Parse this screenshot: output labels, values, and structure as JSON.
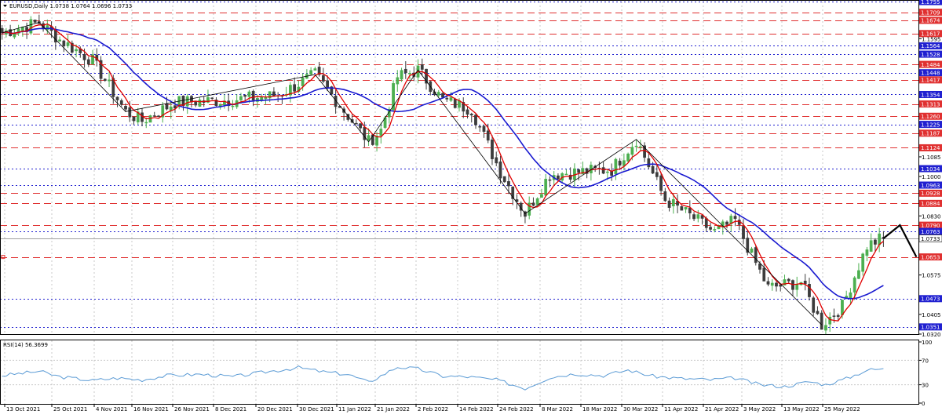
{
  "header": {
    "title": "EURUSD,Daily  1.0738 1.0764 1.0696 1.0733",
    "rsi_label": "RSI(14) 56.3699"
  },
  "colors": {
    "bull": "#4caf50",
    "bear": "#3c3c3c",
    "ma_fast": "#e00000",
    "ma_slow": "#1a1ad0",
    "support": "#2020d0",
    "resistance": "#e03030",
    "rsi_line": "#5b9bd5",
    "grid": "#c8c8c8"
  },
  "chart_data": [
    {
      "type": "candlestick",
      "instrument": "EURUSD",
      "timeframe": "Daily",
      "ohlc_latest": {
        "open": 1.0738,
        "high": 1.0764,
        "low": 1.0696,
        "close": 1.0733
      },
      "ylim": [
        1.032,
        1.1755
      ],
      "x_ticks": [
        "13 Oct 2021",
        "25 Oct 2021",
        "4 Nov 2021",
        "16 Nov 2021",
        "26 Nov 2021",
        "8 Dec 2021",
        "20 Dec 2021",
        "30 Dec 2021",
        "11 Jan 2022",
        "21 Jan 2022",
        "2 Feb 2022",
        "14 Feb 2022",
        "24 Feb 2022",
        "8 Mar 2022",
        "18 Mar 2022",
        "30 Mar 2022",
        "11 Apr 2022",
        "21 Apr 2022",
        "3 May 2022",
        "13 May 2022",
        "25 May 2022"
      ],
      "y_ticks_plain": [
        1.1595,
        1.1085,
        1.1,
        1.083,
        1.0575,
        1.0405,
        1.032
      ],
      "levels": [
        {
          "value": 1.1755,
          "label": "1.1755",
          "kind": "support"
        },
        {
          "value": 1.1709,
          "label": "1.1709",
          "kind": "resistance"
        },
        {
          "value": 1.1674,
          "label": "1.1674",
          "kind": "resistance"
        },
        {
          "value": 1.1617,
          "label": "1.1617",
          "kind": "resistance"
        },
        {
          "value": 1.1564,
          "label": "1.1564",
          "kind": "support"
        },
        {
          "value": 1.1528,
          "label": "1.1528",
          "kind": "support"
        },
        {
          "value": 1.1484,
          "label": "1.1484",
          "kind": "resistance"
        },
        {
          "value": 1.1448,
          "label": "1.1448",
          "kind": "support"
        },
        {
          "value": 1.1417,
          "label": "1.1417",
          "kind": "resistance"
        },
        {
          "value": 1.1354,
          "label": "1.1354",
          "kind": "support"
        },
        {
          "value": 1.1313,
          "label": "1.1313",
          "kind": "resistance"
        },
        {
          "value": 1.126,
          "label": "1.1260",
          "kind": "resistance"
        },
        {
          "value": 1.1225,
          "label": "1.1225",
          "kind": "support"
        },
        {
          "value": 1.1187,
          "label": "1.1187",
          "kind": "resistance"
        },
        {
          "value": 1.1124,
          "label": "1.1124",
          "kind": "resistance"
        },
        {
          "value": 1.1034,
          "label": "1.1034",
          "kind": "support"
        },
        {
          "value": 1.0963,
          "label": "1.0963",
          "kind": "support"
        },
        {
          "value": 1.0928,
          "label": "1.0928",
          "kind": "resistance"
        },
        {
          "value": 1.0884,
          "label": "1.0884",
          "kind": "resistance"
        },
        {
          "value": 1.079,
          "label": "1.0790",
          "kind": "resistance"
        },
        {
          "value": 1.0763,
          "label": "1.0763",
          "kind": "support"
        },
        {
          "value": 1.0653,
          "label": "1.0653",
          "kind": "resistance"
        },
        {
          "value": 1.0473,
          "label": "1.0473",
          "kind": "support"
        },
        {
          "value": 1.0351,
          "label": "1.0351",
          "kind": "support"
        }
      ],
      "current_price": {
        "value": 1.0733,
        "label": "1.0733"
      },
      "anchors": [
        [
          0,
          1.162
        ],
        [
          9,
          1.1665
        ],
        [
          14,
          1.159
        ],
        [
          22,
          1.15
        ],
        [
          30,
          1.128
        ],
        [
          34,
          1.124
        ],
        [
          42,
          1.132
        ],
        [
          55,
          1.133
        ],
        [
          67,
          1.135
        ],
        [
          76,
          1.144
        ],
        [
          81,
          1.133
        ],
        [
          89,
          1.115
        ],
        [
          92,
          1.12
        ],
        [
          96,
          1.143
        ],
        [
          101,
          1.146
        ],
        [
          107,
          1.133
        ],
        [
          114,
          1.129
        ],
        [
          121,
          1.102
        ],
        [
          127,
          1.084
        ],
        [
          133,
          1.101
        ],
        [
          140,
          1.102
        ],
        [
          148,
          1.103
        ],
        [
          154,
          1.116
        ],
        [
          161,
          1.09
        ],
        [
          168,
          1.082
        ],
        [
          173,
          1.076
        ],
        [
          178,
          1.081
        ],
        [
          182,
          1.066
        ],
        [
          186,
          1.052
        ],
        [
          194,
          1.0545
        ],
        [
          199,
          1.036
        ],
        [
          204,
          1.044
        ],
        [
          210,
          1.07
        ],
        [
          214,
          1.0738
        ]
      ],
      "zigzag_projection": [
        {
          "bar": 214,
          "price": 1.0733
        },
        {
          "bar": 218,
          "price": 1.079
        },
        {
          "bar": 222,
          "price": 1.0653
        }
      ]
    },
    {
      "type": "line",
      "name": "RSI(14)",
      "value_latest": 56.3699,
      "ylim": [
        0,
        100
      ],
      "y_ticks": [
        "100",
        "70",
        "30",
        "0"
      ],
      "levels": [
        70,
        30
      ],
      "anchors": [
        [
          0,
          45
        ],
        [
          9,
          52
        ],
        [
          14,
          43
        ],
        [
          22,
          37
        ],
        [
          28,
          41
        ],
        [
          34,
          38
        ],
        [
          40,
          45
        ],
        [
          48,
          47
        ],
        [
          56,
          43
        ],
        [
          64,
          51
        ],
        [
          72,
          58
        ],
        [
          78,
          51
        ],
        [
          84,
          47
        ],
        [
          89,
          34
        ],
        [
          96,
          59
        ],
        [
          101,
          56
        ],
        [
          107,
          44
        ],
        [
          113,
          43
        ],
        [
          120,
          38
        ],
        [
          127,
          24
        ],
        [
          133,
          42
        ],
        [
          139,
          48
        ],
        [
          146,
          45
        ],
        [
          152,
          54
        ],
        [
          158,
          44
        ],
        [
          165,
          40
        ],
        [
          172,
          38
        ],
        [
          178,
          41
        ],
        [
          184,
          30
        ],
        [
          190,
          27
        ],
        [
          196,
          35
        ],
        [
          200,
          30
        ],
        [
          205,
          40
        ],
        [
          210,
          54
        ],
        [
          214,
          56
        ]
      ]
    }
  ]
}
